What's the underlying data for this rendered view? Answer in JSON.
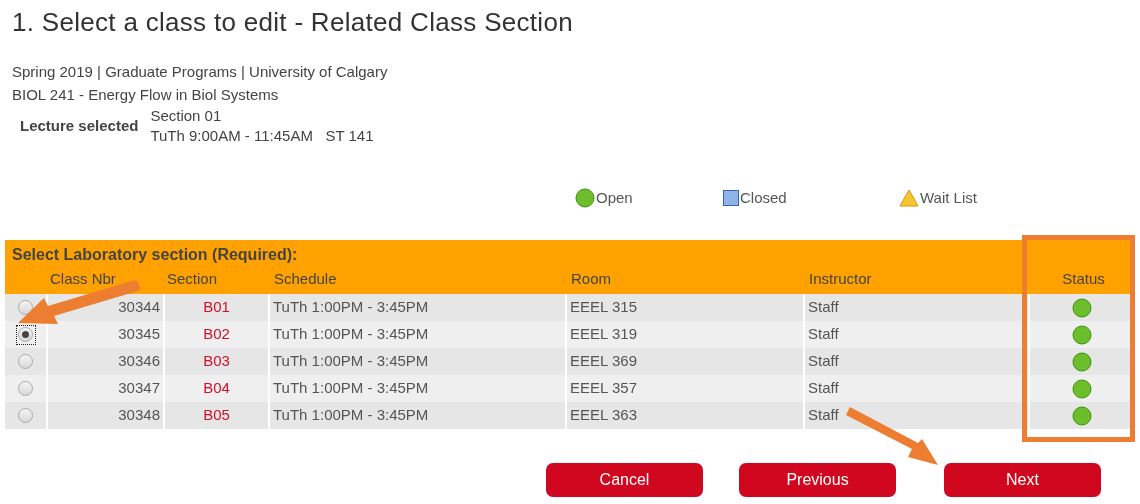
{
  "title": "1.  Select a class to edit - Related Class Section",
  "info_lines": [
    "Spring 2019 | Graduate Programs | University of Calgary",
    "BIOL  241 - Energy Flow in Biol Systems"
  ],
  "lecture": {
    "label": "Lecture selected",
    "section": "Section 01",
    "schedule": "TuTh 9:00AM - 11:45AM   ST 141"
  },
  "legend": [
    {
      "kind": "open",
      "label": "Open"
    },
    {
      "kind": "closed",
      "label": "Closed"
    },
    {
      "kind": "waitlist",
      "label": "Wait List"
    }
  ],
  "table": {
    "caption": "Select Laboratory section (Required):",
    "columns": [
      "Class Nbr",
      "Section",
      "Schedule",
      "Room",
      "Instructor",
      "Status"
    ],
    "rows": [
      {
        "selected": false,
        "class_nbr": "30344",
        "section": "B01",
        "schedule": "TuTh 1:00PM - 3:45PM",
        "room": "EEEL 315",
        "instructor": "Staff",
        "status": {
          "kind": "open"
        }
      },
      {
        "selected": true,
        "class_nbr": "30345",
        "section": "B02",
        "schedule": "TuTh 1:00PM - 3:45PM",
        "room": "EEEL 319",
        "instructor": "Staff",
        "status": {
          "kind": "open"
        }
      },
      {
        "selected": false,
        "class_nbr": "30346",
        "section": "B03",
        "schedule": "TuTh 1:00PM - 3:45PM",
        "room": "EEEL 369",
        "instructor": "Staff",
        "status": {
          "kind": "open"
        }
      },
      {
        "selected": false,
        "class_nbr": "30347",
        "section": "B04",
        "schedule": "TuTh 1:00PM - 3:45PM",
        "room": "EEEL 357",
        "instructor": "Staff",
        "status": {
          "kind": "open"
        }
      },
      {
        "selected": false,
        "class_nbr": "30348",
        "section": "B05",
        "schedule": "TuTh 1:00PM - 3:45PM",
        "room": "EEEL 363",
        "instructor": "Staff",
        "status": {
          "kind": "open"
        }
      }
    ]
  },
  "buttons": [
    "Cancel",
    "Previous",
    "Next"
  ]
}
